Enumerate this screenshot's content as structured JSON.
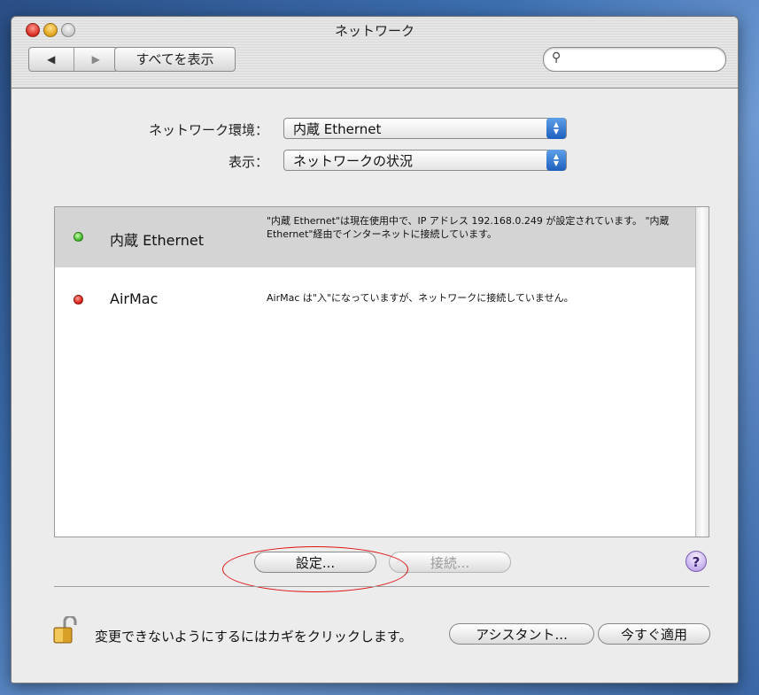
{
  "window": {
    "title": "ネットワーク"
  },
  "toolbar": {
    "back_label": "◀",
    "forward_label": "▶",
    "show_all_label": "すべてを表示",
    "search_icon": "🔍",
    "search_placeholder": ""
  },
  "location": {
    "label": "ネットワーク環境：",
    "value": "内蔵 Ethernet"
  },
  "show": {
    "label": "表示：",
    "value": "ネットワークの状況"
  },
  "services": [
    {
      "name": "内蔵 Ethernet",
      "status": "green",
      "selected": true,
      "description": "\"内蔵 Ethernet\"は現在使用中で、IP アドレス 192.168.0.249 が設定されています。 \"内蔵 Ethernet\"経由でインターネットに接続しています。"
    },
    {
      "name": "AirMac",
      "status": "red",
      "selected": false,
      "description": "AirMac は\"入\"になっていますが、ネットワークに接続していません。"
    }
  ],
  "buttons": {
    "configure_label": "設定...",
    "connect_label": "接続...",
    "help_label": "?",
    "assistant_label": "アシスタント...",
    "apply_label": "今すぐ適用"
  },
  "lock": {
    "icon": "lock-icon",
    "text": "変更できないようにするにはカギをクリックします。"
  },
  "colors": {
    "status_green": "#35b21b",
    "status_red": "#d8160b",
    "annotation": "#e01010"
  }
}
